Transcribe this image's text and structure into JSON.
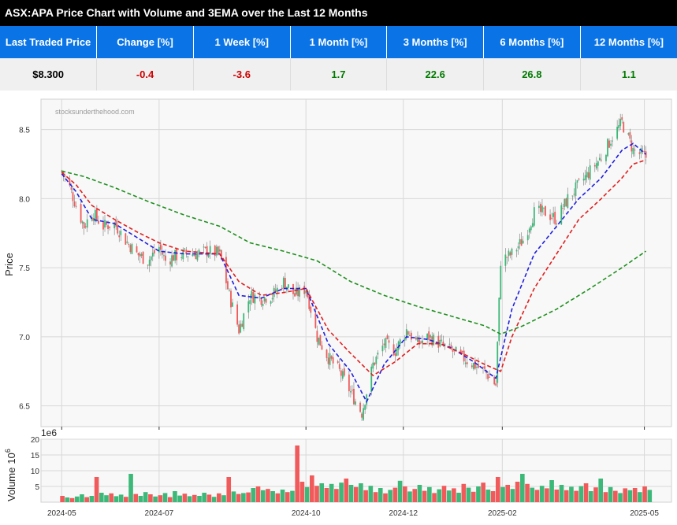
{
  "title": "ASX:APA Price Chart with Volume and 3EMA over the Last 12 Months",
  "stats": {
    "headers": [
      "Last Traded Price",
      "Change [%]",
      "1 Week [%]",
      "1 Month [%]",
      "3 Months [%]",
      "6 Months [%]",
      "12 Months [%]"
    ],
    "values": [
      "$8.300",
      "-0.4",
      "-3.6",
      "1.7",
      "22.6",
      "26.8",
      "1.1"
    ],
    "value_colors": [
      "#000000",
      "#cc0000",
      "#cc0000",
      "#007a00",
      "#007a00",
      "#007a00",
      "#007a00"
    ]
  },
  "chart_data": {
    "type": "line",
    "watermark": "stocksunderthehood.com",
    "price_panel": {
      "ylabel": "Price",
      "ylim": [
        6.35,
        8.72
      ],
      "yticks": [
        "6.5",
        "7.0",
        "7.5",
        "8.0",
        "8.5"
      ],
      "ytick_values": [
        6.5,
        7.0,
        7.5,
        8.0,
        8.5
      ],
      "grid": true,
      "close_series": [
        [
          "2024-05-01",
          8.2
        ],
        [
          "2024-05-06",
          8.08
        ],
        [
          "2024-05-10",
          7.95
        ],
        [
          "2024-05-15",
          7.8
        ],
        [
          "2024-05-20",
          7.9
        ],
        [
          "2024-05-27",
          7.8
        ],
        [
          "2024-06-03",
          7.82
        ],
        [
          "2024-06-10",
          7.7
        ],
        [
          "2024-06-17",
          7.6
        ],
        [
          "2024-06-24",
          7.55
        ],
        [
          "2024-07-01",
          7.65
        ],
        [
          "2024-07-05",
          7.55
        ],
        [
          "2024-07-10",
          7.58
        ],
        [
          "2024-07-17",
          7.6
        ],
        [
          "2024-07-24",
          7.6
        ],
        [
          "2024-07-31",
          7.62
        ],
        [
          "2024-08-08",
          7.6
        ],
        [
          "2024-08-14",
          7.3
        ],
        [
          "2024-08-20",
          7.05
        ],
        [
          "2024-08-27",
          7.3
        ],
        [
          "2024-09-03",
          7.28
        ],
        [
          "2024-09-10",
          7.3
        ],
        [
          "2024-09-17",
          7.4
        ],
        [
          "2024-09-24",
          7.3
        ],
        [
          "2024-10-01",
          7.35
        ],
        [
          "2024-10-08",
          7.0
        ],
        [
          "2024-10-15",
          6.85
        ],
        [
          "2024-10-22",
          6.75
        ],
        [
          "2024-10-29",
          6.6
        ],
        [
          "2024-11-05",
          6.45
        ],
        [
          "2024-11-12",
          6.8
        ],
        [
          "2024-11-19",
          6.95
        ],
        [
          "2024-11-26",
          6.9
        ],
        [
          "2024-12-03",
          7.05
        ],
        [
          "2024-12-10",
          6.95
        ],
        [
          "2024-12-17",
          7.0
        ],
        [
          "2024-12-24",
          6.95
        ],
        [
          "2024-12-31",
          6.9
        ],
        [
          "2025-01-07",
          6.85
        ],
        [
          "2025-01-14",
          6.8
        ],
        [
          "2025-01-21",
          6.75
        ],
        [
          "2025-01-28",
          6.65
        ],
        [
          "2025-01-31",
          7.55
        ],
        [
          "2025-02-07",
          7.6
        ],
        [
          "2025-02-14",
          7.7
        ],
        [
          "2025-02-21",
          7.9
        ],
        [
          "2025-02-28",
          7.9
        ],
        [
          "2025-03-07",
          7.85
        ],
        [
          "2025-03-14",
          8.0
        ],
        [
          "2025-03-21",
          8.1
        ],
        [
          "2025-03-28",
          8.2
        ],
        [
          "2025-04-04",
          8.3
        ],
        [
          "2025-04-11",
          8.45
        ],
        [
          "2025-04-17",
          8.55
        ],
        [
          "2025-04-24",
          8.35
        ],
        [
          "2025-05-02",
          8.3
        ]
      ],
      "ema_series": [
        {
          "color": "#1f1fe0",
          "values": [
            [
              "2024-05-01",
              8.18
            ],
            [
              "2024-05-10",
              8.05
            ],
            [
              "2024-05-20",
              7.85
            ],
            [
              "2024-06-03",
              7.82
            ],
            [
              "2024-06-17",
              7.72
            ],
            [
              "2024-07-01",
              7.62
            ],
            [
              "2024-07-17",
              7.6
            ],
            [
              "2024-08-08",
              7.6
            ],
            [
              "2024-08-20",
              7.3
            ],
            [
              "2024-09-03",
              7.28
            ],
            [
              "2024-09-17",
              7.35
            ],
            [
              "2024-10-01",
              7.35
            ],
            [
              "2024-10-15",
              6.95
            ],
            [
              "2024-10-29",
              6.75
            ],
            [
              "2024-11-08",
              6.53
            ],
            [
              "2024-11-19",
              6.8
            ],
            [
              "2024-12-03",
              7.0
            ],
            [
              "2024-12-17",
              6.98
            ],
            [
              "2024-12-31",
              6.92
            ],
            [
              "2025-01-14",
              6.82
            ],
            [
              "2025-01-28",
              6.7
            ],
            [
              "2025-02-07",
              7.2
            ],
            [
              "2025-02-21",
              7.6
            ],
            [
              "2025-03-07",
              7.8
            ],
            [
              "2025-03-21",
              8.0
            ],
            [
              "2025-04-04",
              8.15
            ],
            [
              "2025-04-17",
              8.35
            ],
            [
              "2025-04-24",
              8.4
            ],
            [
              "2025-05-02",
              8.32
            ]
          ]
        },
        {
          "color": "#e01f1f",
          "values": [
            [
              "2024-05-01",
              8.19
            ],
            [
              "2024-05-10",
              8.1
            ],
            [
              "2024-05-20",
              7.95
            ],
            [
              "2024-06-03",
              7.85
            ],
            [
              "2024-06-17",
              7.76
            ],
            [
              "2024-07-01",
              7.68
            ],
            [
              "2024-07-17",
              7.62
            ],
            [
              "2024-08-08",
              7.6
            ],
            [
              "2024-08-20",
              7.4
            ],
            [
              "2024-09-03",
              7.3
            ],
            [
              "2024-09-17",
              7.32
            ],
            [
              "2024-10-01",
              7.35
            ],
            [
              "2024-10-15",
              7.05
            ],
            [
              "2024-10-29",
              6.88
            ],
            [
              "2024-11-12",
              6.72
            ],
            [
              "2024-11-26",
              6.82
            ],
            [
              "2024-12-10",
              6.95
            ],
            [
              "2024-12-24",
              6.95
            ],
            [
              "2025-01-07",
              6.88
            ],
            [
              "2025-01-21",
              6.8
            ],
            [
              "2025-01-31",
              6.75
            ],
            [
              "2025-02-07",
              7.0
            ],
            [
              "2025-02-21",
              7.35
            ],
            [
              "2025-03-07",
              7.6
            ],
            [
              "2025-03-21",
              7.85
            ],
            [
              "2025-04-04",
              8.0
            ],
            [
              "2025-04-17",
              8.15
            ],
            [
              "2025-04-24",
              8.25
            ],
            [
              "2025-05-02",
              8.28
            ]
          ]
        },
        {
          "color": "#1f8f1f",
          "values": [
            [
              "2024-05-01",
              8.2
            ],
            [
              "2024-05-15",
              8.16
            ],
            [
              "2024-06-03",
              8.08
            ],
            [
              "2024-06-24",
              7.98
            ],
            [
              "2024-07-17",
              7.88
            ],
            [
              "2024-08-08",
              7.8
            ],
            [
              "2024-08-27",
              7.68
            ],
            [
              "2024-09-17",
              7.62
            ],
            [
              "2024-10-08",
              7.55
            ],
            [
              "2024-10-29",
              7.4
            ],
            [
              "2024-11-19",
              7.3
            ],
            [
              "2024-12-10",
              7.22
            ],
            [
              "2024-12-31",
              7.15
            ],
            [
              "2025-01-21",
              7.08
            ],
            [
              "2025-01-31",
              7.02
            ],
            [
              "2025-02-14",
              7.08
            ],
            [
              "2025-03-07",
              7.2
            ],
            [
              "2025-03-28",
              7.35
            ],
            [
              "2025-04-17",
              7.5
            ],
            [
              "2025-05-02",
              7.62
            ]
          ]
        }
      ]
    },
    "volume_panel": {
      "ylabel": "Volume",
      "ylabel_sup": "6",
      "ylabel_base": "10",
      "offset_text": "1e6",
      "ylim": [
        0,
        20
      ],
      "yticks": [
        "5",
        "10",
        "15",
        "20"
      ],
      "ytick_values": [
        5,
        10,
        15,
        20
      ],
      "up_color": "#3cb878",
      "down_color": "#f05a5a",
      "bars": [
        [
          2.0,
          0
        ],
        [
          1.5,
          1
        ],
        [
          1.3,
          0
        ],
        [
          1.8,
          1
        ],
        [
          2.5,
          1
        ],
        [
          1.6,
          0
        ],
        [
          2.0,
          1
        ],
        [
          8.0,
          0
        ],
        [
          3.0,
          1
        ],
        [
          2.2,
          1
        ],
        [
          2.8,
          0
        ],
        [
          1.9,
          1
        ],
        [
          2.4,
          1
        ],
        [
          1.7,
          0
        ],
        [
          9.0,
          1
        ],
        [
          2.6,
          0
        ],
        [
          2.0,
          1
        ],
        [
          3.2,
          1
        ],
        [
          2.5,
          0
        ],
        [
          1.8,
          1
        ],
        [
          2.2,
          0
        ],
        [
          2.9,
          1
        ],
        [
          1.6,
          0
        ],
        [
          3.5,
          1
        ],
        [
          2.1,
          1
        ],
        [
          2.7,
          0
        ],
        [
          1.9,
          1
        ],
        [
          2.3,
          0
        ],
        [
          2.0,
          1
        ],
        [
          3.0,
          1
        ],
        [
          2.4,
          0
        ],
        [
          1.7,
          1
        ],
        [
          2.8,
          0
        ],
        [
          2.2,
          1
        ],
        [
          8.0,
          0
        ],
        [
          3.4,
          1
        ],
        [
          2.6,
          0
        ],
        [
          2.9,
          1
        ],
        [
          3.1,
          0
        ],
        [
          4.5,
          1
        ],
        [
          5.0,
          0
        ],
        [
          3.8,
          1
        ],
        [
          4.2,
          0
        ],
        [
          3.5,
          1
        ],
        [
          2.8,
          0
        ],
        [
          4.0,
          1
        ],
        [
          3.2,
          0
        ],
        [
          3.6,
          1
        ],
        [
          18.0,
          0
        ],
        [
          6.5,
          0
        ],
        [
          4.8,
          1
        ],
        [
          8.5,
          0
        ],
        [
          5.2,
          0
        ],
        [
          6.0,
          1
        ],
        [
          4.5,
          0
        ],
        [
          5.8,
          1
        ],
        [
          4.2,
          0
        ],
        [
          6.2,
          1
        ],
        [
          7.5,
          0
        ],
        [
          5.5,
          1
        ],
        [
          4.8,
          0
        ],
        [
          6.0,
          1
        ],
        [
          3.8,
          0
        ],
        [
          5.2,
          1
        ],
        [
          3.2,
          0
        ],
        [
          4.5,
          1
        ],
        [
          2.8,
          0
        ],
        [
          3.9,
          1
        ],
        [
          4.6,
          0
        ],
        [
          6.8,
          1
        ],
        [
          5.0,
          0
        ],
        [
          3.4,
          1
        ],
        [
          4.2,
          0
        ],
        [
          5.5,
          1
        ],
        [
          3.6,
          0
        ],
        [
          4.8,
          1
        ],
        [
          2.9,
          0
        ],
        [
          4.1,
          1
        ],
        [
          5.2,
          0
        ],
        [
          3.7,
          1
        ],
        [
          4.4,
          0
        ],
        [
          3.0,
          1
        ],
        [
          5.8,
          0
        ],
        [
          4.6,
          1
        ],
        [
          3.3,
          0
        ],
        [
          5.0,
          1
        ],
        [
          6.2,
          0
        ],
        [
          4.0,
          1
        ],
        [
          3.5,
          0
        ],
        [
          8.0,
          0
        ],
        [
          4.8,
          1
        ],
        [
          5.5,
          0
        ],
        [
          4.2,
          1
        ],
        [
          6.5,
          0
        ],
        [
          9.0,
          1
        ],
        [
          5.8,
          0
        ],
        [
          4.6,
          1
        ],
        [
          3.9,
          0
        ],
        [
          5.2,
          1
        ],
        [
          4.4,
          0
        ],
        [
          7.0,
          1
        ],
        [
          4.0,
          0
        ],
        [
          5.5,
          1
        ],
        [
          3.8,
          0
        ],
        [
          4.9,
          1
        ],
        [
          3.6,
          0
        ],
        [
          5.1,
          1
        ],
        [
          6.0,
          0
        ],
        [
          3.5,
          1
        ],
        [
          4.7,
          0
        ],
        [
          7.5,
          1
        ],
        [
          3.2,
          0
        ],
        [
          4.8,
          1
        ],
        [
          3.6,
          0
        ],
        [
          2.9,
          1
        ],
        [
          4.4,
          0
        ],
        [
          3.8,
          1
        ],
        [
          4.5,
          0
        ],
        [
          3.2,
          1
        ],
        [
          5.0,
          0
        ],
        [
          3.9,
          1
        ]
      ]
    },
    "x_axis": {
      "xlim": [
        "2024-04-18",
        "2025-05-18"
      ],
      "ticks": [
        "2024-05",
        "2024-07",
        "2024-10",
        "2024-12",
        "2025-02",
        "2025-05"
      ],
      "tick_dates": [
        "2024-05-01",
        "2024-07-01",
        "2024-10-01",
        "2024-12-01",
        "2025-02-01",
        "2025-05-01"
      ]
    }
  }
}
